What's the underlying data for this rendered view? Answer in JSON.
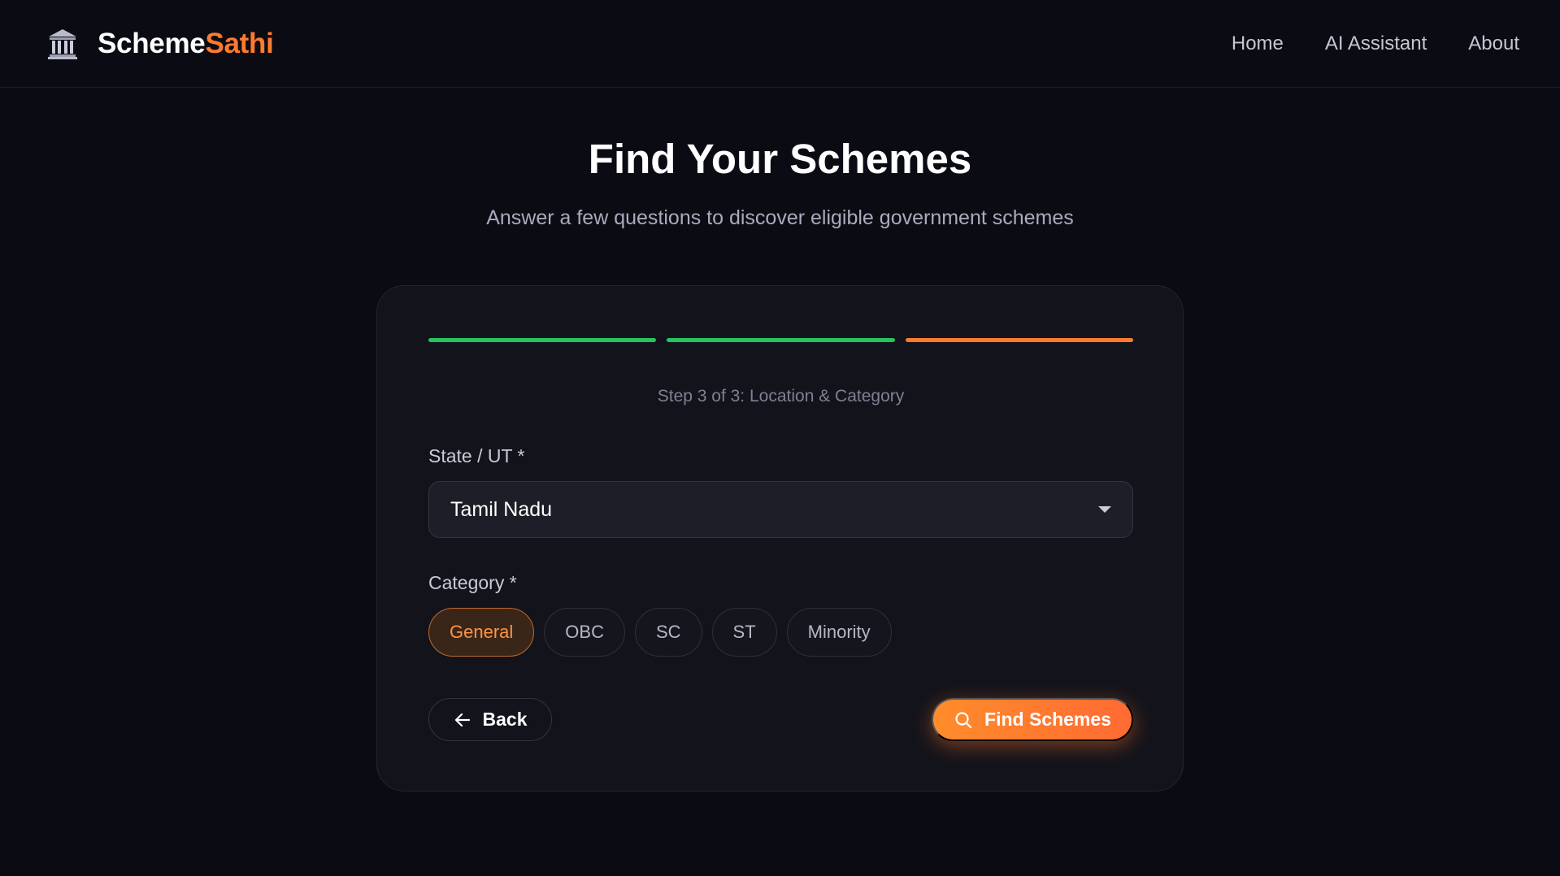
{
  "header": {
    "brand_part1": "Scheme",
    "brand_part2": "Sathi",
    "nav": [
      {
        "label": "Home"
      },
      {
        "label": "AI Assistant"
      },
      {
        "label": "About"
      }
    ]
  },
  "hero": {
    "title": "Find Your Schemes",
    "subtitle": "Answer a few questions to discover eligible government schemes"
  },
  "wizard": {
    "current_step": 3,
    "total_steps": 3,
    "steps": [
      {
        "status": "complete",
        "color": "#22c55e"
      },
      {
        "status": "complete",
        "color": "#22c55e"
      },
      {
        "status": "current",
        "color": "#ff7a2e"
      }
    ],
    "step_label": "Step 3 of 3: Location & Category",
    "state_field": {
      "label": "State / UT *",
      "value": "Tamil Nadu"
    },
    "category_field": {
      "label": "Category *",
      "options": [
        {
          "label": "General",
          "selected": true
        },
        {
          "label": "OBC",
          "selected": false
        },
        {
          "label": "SC",
          "selected": false
        },
        {
          "label": "ST",
          "selected": false
        },
        {
          "label": "Minority",
          "selected": false
        }
      ]
    },
    "back_label": "Back",
    "submit_label": "Find Schemes"
  },
  "icons": {
    "brand": "bank-building-icon",
    "back": "arrow-left-icon",
    "submit": "search-icon",
    "select": "chevron-down-icon"
  },
  "colors": {
    "accent": "#ff7a2e",
    "success": "#22c55e",
    "background": "#0b0c13",
    "card": "#13141b"
  }
}
